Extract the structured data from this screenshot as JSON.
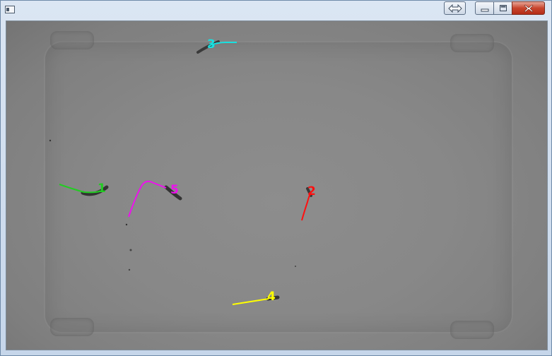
{
  "window": {
    "title": "",
    "buttons": {
      "resize_icon": "double-arrow-icon",
      "minimize_icon": "minimize-icon",
      "maximize_icon": "maximize-icon",
      "close_icon": "close-icon"
    }
  },
  "tracks": [
    {
      "id": "1",
      "label": "1",
      "color": "#22cc22"
    },
    {
      "id": "2",
      "label": "2",
      "color": "#ff1010"
    },
    {
      "id": "3",
      "label": "3",
      "color": "#18e0e0"
    },
    {
      "id": "4",
      "label": "4",
      "color": "#ffff00"
    },
    {
      "id": "5",
      "label": "5",
      "color": "#ee10ee"
    }
  ]
}
